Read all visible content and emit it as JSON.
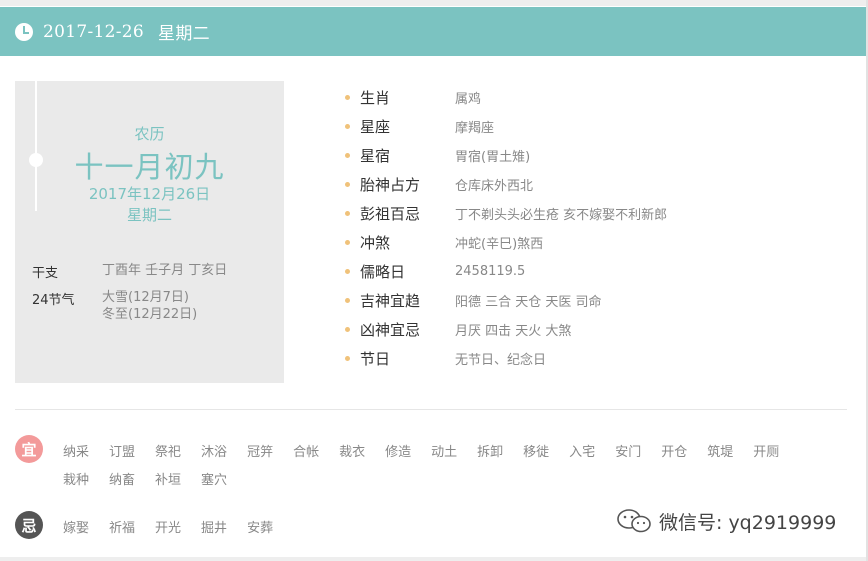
{
  "header": {
    "date": "2017-12-26",
    "weekday": "星期二",
    "accent_color": "#7bc3c1"
  },
  "card": {
    "lunar_label": "农历",
    "lunar_date": "十一月初九",
    "solar_date": "2017年12月26日",
    "weekday": "星期二",
    "ganzhi_label": "干支",
    "ganzhi_value": "丁酉年 壬子月 丁亥日",
    "jieqi_label": "24节气",
    "jieqi_line1": "大雪(12月7日)",
    "jieqi_line2": "冬至(12月22日)"
  },
  "info": [
    {
      "label": "生肖",
      "value": "属鸡"
    },
    {
      "label": "星座",
      "value": "摩羯座"
    },
    {
      "label": "星宿",
      "value": "胃宿(胃土雉)"
    },
    {
      "label": "胎神占方",
      "value": "仓库床外西北"
    },
    {
      "label": "彭祖百忌",
      "value": "丁不剃头头必生疮 亥不嫁娶不利新郎"
    },
    {
      "label": "冲煞",
      "value": "冲蛇(辛巳)煞西"
    },
    {
      "label": "儒略日",
      "value": "2458119.5"
    },
    {
      "label": "吉神宜趋",
      "value": "阳德 三合 天仓 天医 司命"
    },
    {
      "label": "凶神宜忌",
      "value": "月厌 四击 天火 大煞"
    },
    {
      "label": "节日",
      "value": "无节日、纪念日"
    }
  ],
  "yi": {
    "badge": "宜",
    "badge_color": "#f39a9a",
    "items": [
      "纳采",
      "订盟",
      "祭祀",
      "沐浴",
      "冠笄",
      "合帐",
      "裁衣",
      "修造",
      "动土",
      "拆卸",
      "移徙",
      "入宅",
      "安门",
      "开仓",
      "筑堤",
      "开厕",
      "栽种",
      "纳畜",
      "补垣",
      "塞穴"
    ]
  },
  "ji": {
    "badge": "忌",
    "badge_color": "#555555",
    "items": [
      "嫁娶",
      "祈福",
      "开光",
      "掘井",
      "安葬"
    ]
  },
  "watermark": {
    "text": "微信号: yq2919999",
    "icon": "wechat-icon"
  }
}
